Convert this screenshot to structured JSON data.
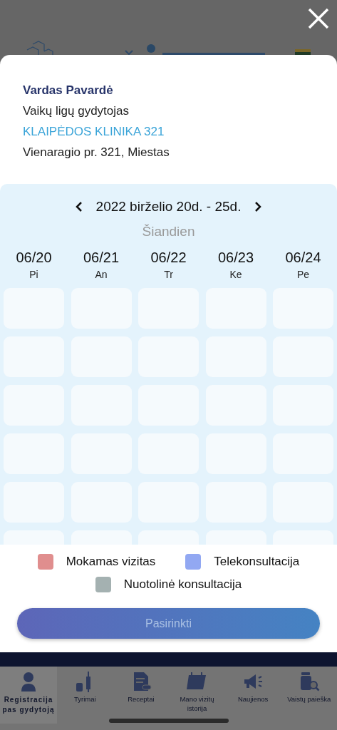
{
  "doctor": {
    "name": "Vardas Pavardė",
    "specialty": "Vaikų ligų gydytojas",
    "clinic": "KLAIPĖDOS KLINIKA 321",
    "address": "Vienaragio pr. 321, Miestas"
  },
  "calendar": {
    "range": "2022 birželio 20d. - 25d.",
    "today": "Šiandien",
    "days": [
      {
        "date": "06/20",
        "weekday": "Pi"
      },
      {
        "date": "06/21",
        "weekday": "An"
      },
      {
        "date": "06/22",
        "weekday": "Tr"
      },
      {
        "date": "06/23",
        "weekday": "Ke"
      },
      {
        "date": "06/24",
        "weekday": "Pe"
      }
    ]
  },
  "legend": [
    {
      "label": "Mokamas vizitas",
      "color": "#e08e8e"
    },
    {
      "label": "Telekonsultacija",
      "color": "#92a8f2"
    },
    {
      "label": "Nuotolinė konsultacija",
      "color": "#a4b1b1"
    }
  ],
  "select_button": {
    "label": "Pasirinkti",
    "disabled": true
  },
  "tab_bar": [
    {
      "kind": "doctor",
      "label": "Registracija pas gydytoją",
      "selected": true
    },
    {
      "kind": "vaccine",
      "label": "Tyrimai",
      "selected": false
    },
    {
      "kind": "prescription",
      "label": "Receptai",
      "selected": false
    },
    {
      "kind": "calendar",
      "label": "Mano vizitų istorija",
      "selected": false
    },
    {
      "kind": "megaphone",
      "label": "Naujienos",
      "selected": false
    },
    {
      "kind": "search",
      "label": "Vaistų paieška",
      "selected": false
    }
  ]
}
